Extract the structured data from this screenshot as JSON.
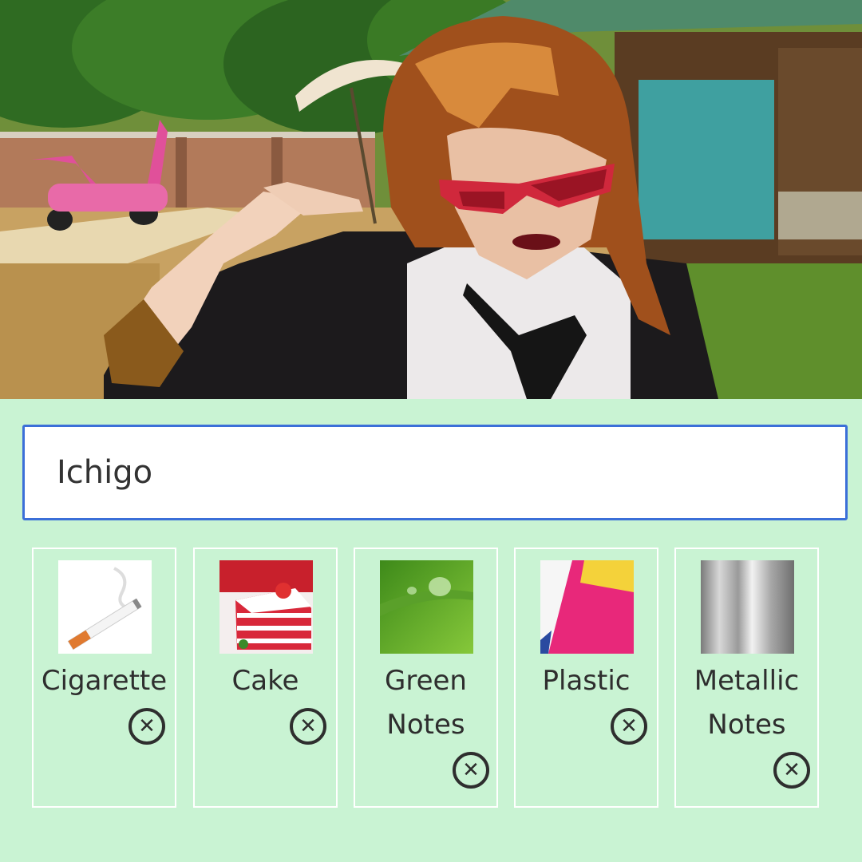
{
  "photo": {
    "icon": "photo-still"
  },
  "search": {
    "value": "Ichigo"
  },
  "tags": [
    {
      "label": "Cigarette",
      "icon": "cigarette-image"
    },
    {
      "label": "Cake",
      "icon": "cake-image"
    },
    {
      "label": "Green Notes",
      "icon": "green-leaf-image"
    },
    {
      "label": "Plastic",
      "icon": "plastic-image"
    },
    {
      "label": "Metallic Notes",
      "icon": "metallic-image"
    }
  ],
  "remove_icon": "close-circle-icon",
  "colors": {
    "background": "#c9f3d3",
    "input_border": "#3b6fd8",
    "tile_border": "#ffffff",
    "text": "#2e2e2e"
  }
}
